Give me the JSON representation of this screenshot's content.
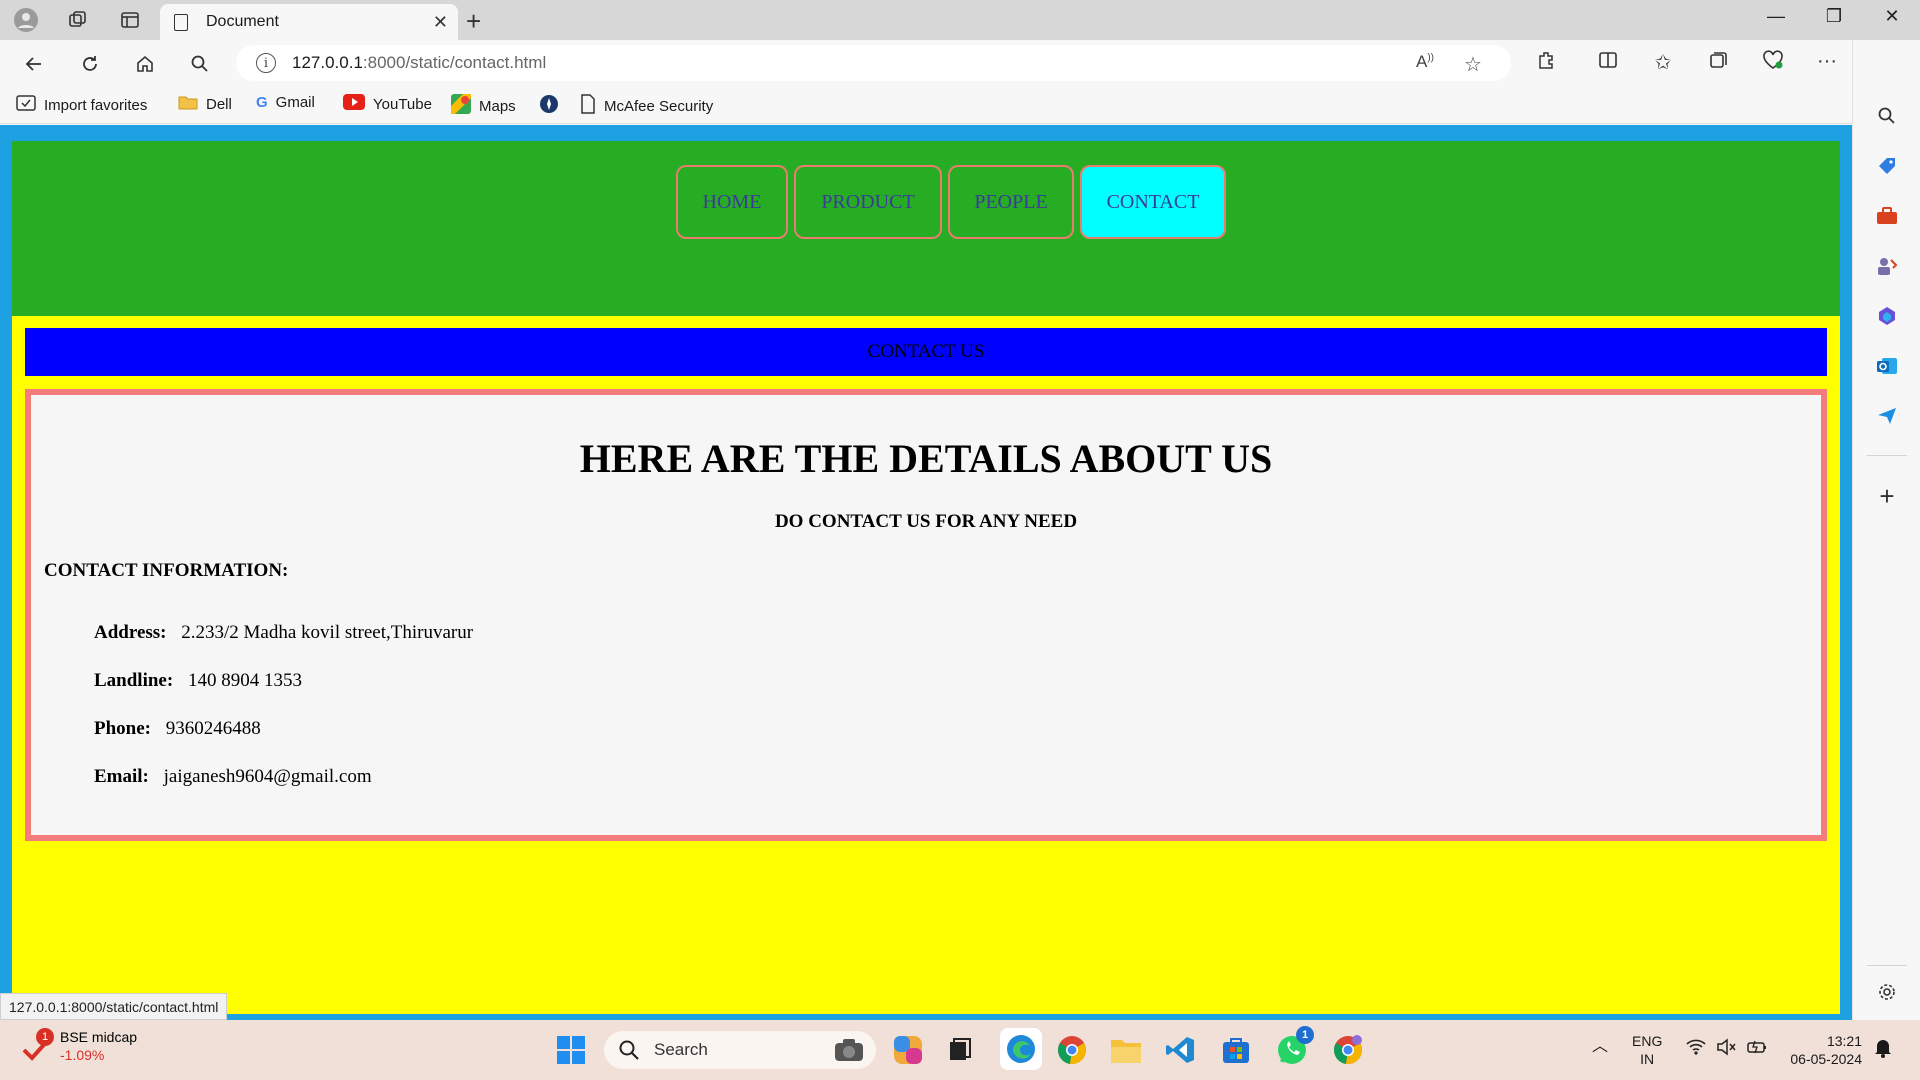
{
  "browser": {
    "tab_title": "Document",
    "address": {
      "host": "127.0.0.1",
      "rest": ":8000/static/contact.html"
    },
    "bookmarks": [
      "Import favorites",
      "Dell",
      "Gmail",
      "YouTube",
      "Maps",
      "McAfee Security"
    ]
  },
  "page": {
    "nav": [
      "HOME",
      "PRODUCT",
      "PEOPLE",
      "CONTACT"
    ],
    "active_nav": "CONTACT",
    "banner": "CONTACT US",
    "title": "HERE ARE THE DETAILS ABOUT US",
    "subtitle": "DO CONTACT US FOR ANY NEED",
    "info_heading": "CONTACT INFORMATION:",
    "info": [
      {
        "label": "Address:",
        "value": "2.233/2 Madha kovil street,Thiruvarur"
      },
      {
        "label": "Landline:",
        "value": "140 8904 1353"
      },
      {
        "label": "Phone:",
        "value": "9360246488"
      },
      {
        "label": "Email:",
        "value": "jaiganesh9604@gmail.com"
      }
    ],
    "colors": {
      "outer_bg": "#1da1e3",
      "nav_bg": "#27ad24",
      "active_nav_bg": "#00ffff",
      "content_bg": "#ffff00",
      "banner_bg": "#0000ff",
      "details_border": "#f47c7c"
    }
  },
  "status_bar_url": "127.0.0.1:8000/static/contact.html",
  "taskbar": {
    "widget_title": "BSE midcap",
    "widget_value": "-1.09%",
    "widget_badge": "1",
    "search_placeholder": "Search",
    "whatsapp_badge": "1",
    "lang_1": "ENG",
    "lang_2": "IN",
    "time": "13:21",
    "date": "06-05-2024"
  }
}
